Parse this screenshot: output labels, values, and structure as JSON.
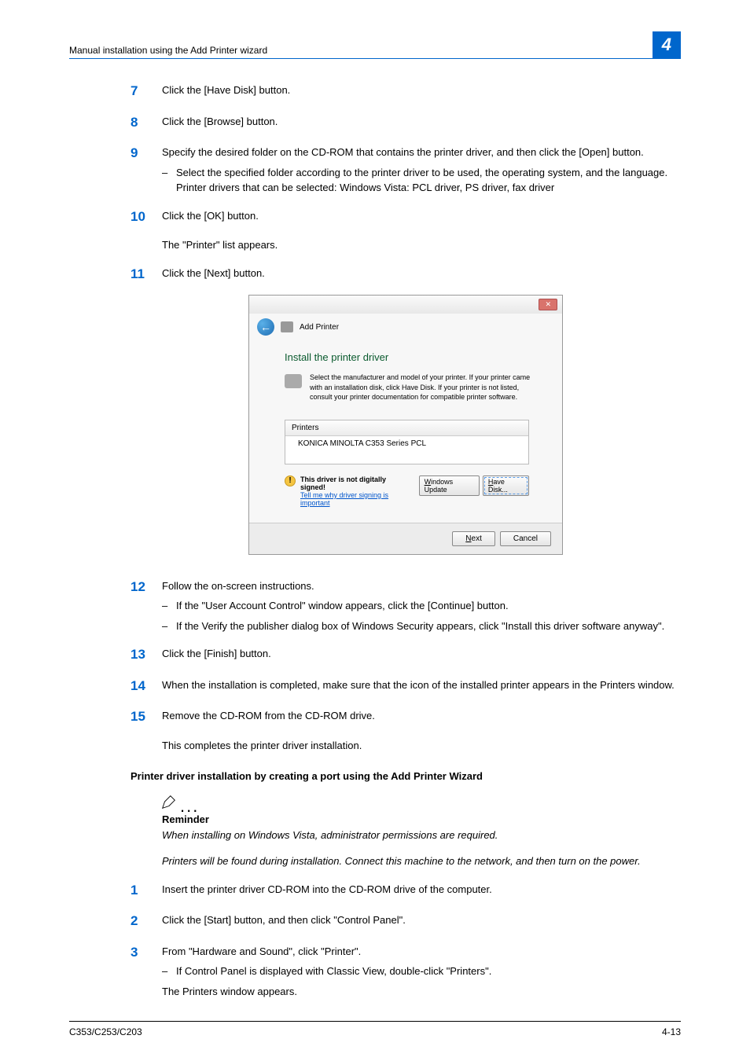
{
  "header": {
    "title": "Manual installation using the Add Printer wizard",
    "chapter": "4"
  },
  "steps_a": [
    {
      "num": "7",
      "text": "Click the [Have Disk] button."
    },
    {
      "num": "8",
      "text": "Click the [Browse] button."
    },
    {
      "num": "9",
      "text": "Specify the desired folder on the CD-ROM that contains the printer driver, and then click the [Open] button.",
      "subs": [
        "Select the specified folder according to the printer driver to be used, the operating system, and the language. Printer drivers that can be selected: Windows Vista: PCL driver, PS driver, fax driver"
      ]
    },
    {
      "num": "10",
      "text": "Click the [OK] button.",
      "after": "The \"Printer\" list appears."
    },
    {
      "num": "11",
      "text": "Click the [Next] button."
    }
  ],
  "screenshot": {
    "window_title": "Add Printer",
    "heading": "Install the printer driver",
    "desc": "Select the manufacturer and model of your printer. If your printer came with an installation disk, click Have Disk. If your printer is not listed, consult your printer documentation for compatible printer software.",
    "list_header": "Printers",
    "list_item": "KONICA MINOLTA C353 Series PCL",
    "warn_bold": "This driver is not digitally signed!",
    "warn_link": "Tell me why driver signing is important",
    "btn_wu": "Windows Update",
    "btn_hd": "Have Disk...",
    "btn_next": "Next",
    "btn_cancel": "Cancel"
  },
  "steps_b": [
    {
      "num": "12",
      "text": "Follow the on-screen instructions.",
      "subs": [
        "If the \"User Account Control\" window appears, click the [Continue] button.",
        "If the Verify the publisher dialog box of Windows Security appears, click \"Install this driver software anyway\"."
      ]
    },
    {
      "num": "13",
      "text": "Click the [Finish] button."
    },
    {
      "num": "14",
      "text": "When the installation is completed, make sure that the icon of the installed printer appears in the Printers window."
    },
    {
      "num": "15",
      "text": "Remove the CD-ROM from the CD-ROM drive.",
      "after": "This completes the printer driver installation."
    }
  ],
  "section2": {
    "heading": "Printer driver installation by creating a port using the Add Printer Wizard",
    "reminder_label": "Reminder",
    "reminder_lines": [
      "When installing on Windows Vista, administrator permissions are required.",
      "Printers will be found during installation. Connect this machine to the network, and then turn on the power."
    ],
    "steps": [
      {
        "num": "1",
        "text": "Insert the printer driver CD-ROM into the CD-ROM drive of the computer."
      },
      {
        "num": "2",
        "text": "Click the [Start] button, and then click \"Control Panel\"."
      },
      {
        "num": "3",
        "text": "From \"Hardware and Sound\", click \"Printer\".",
        "subs": [
          "If Control Panel is displayed with Classic View, double-click \"Printers\"."
        ],
        "after": "The Printers window appears."
      }
    ]
  },
  "footer": {
    "left": "C353/C253/C203",
    "right": "4-13"
  }
}
